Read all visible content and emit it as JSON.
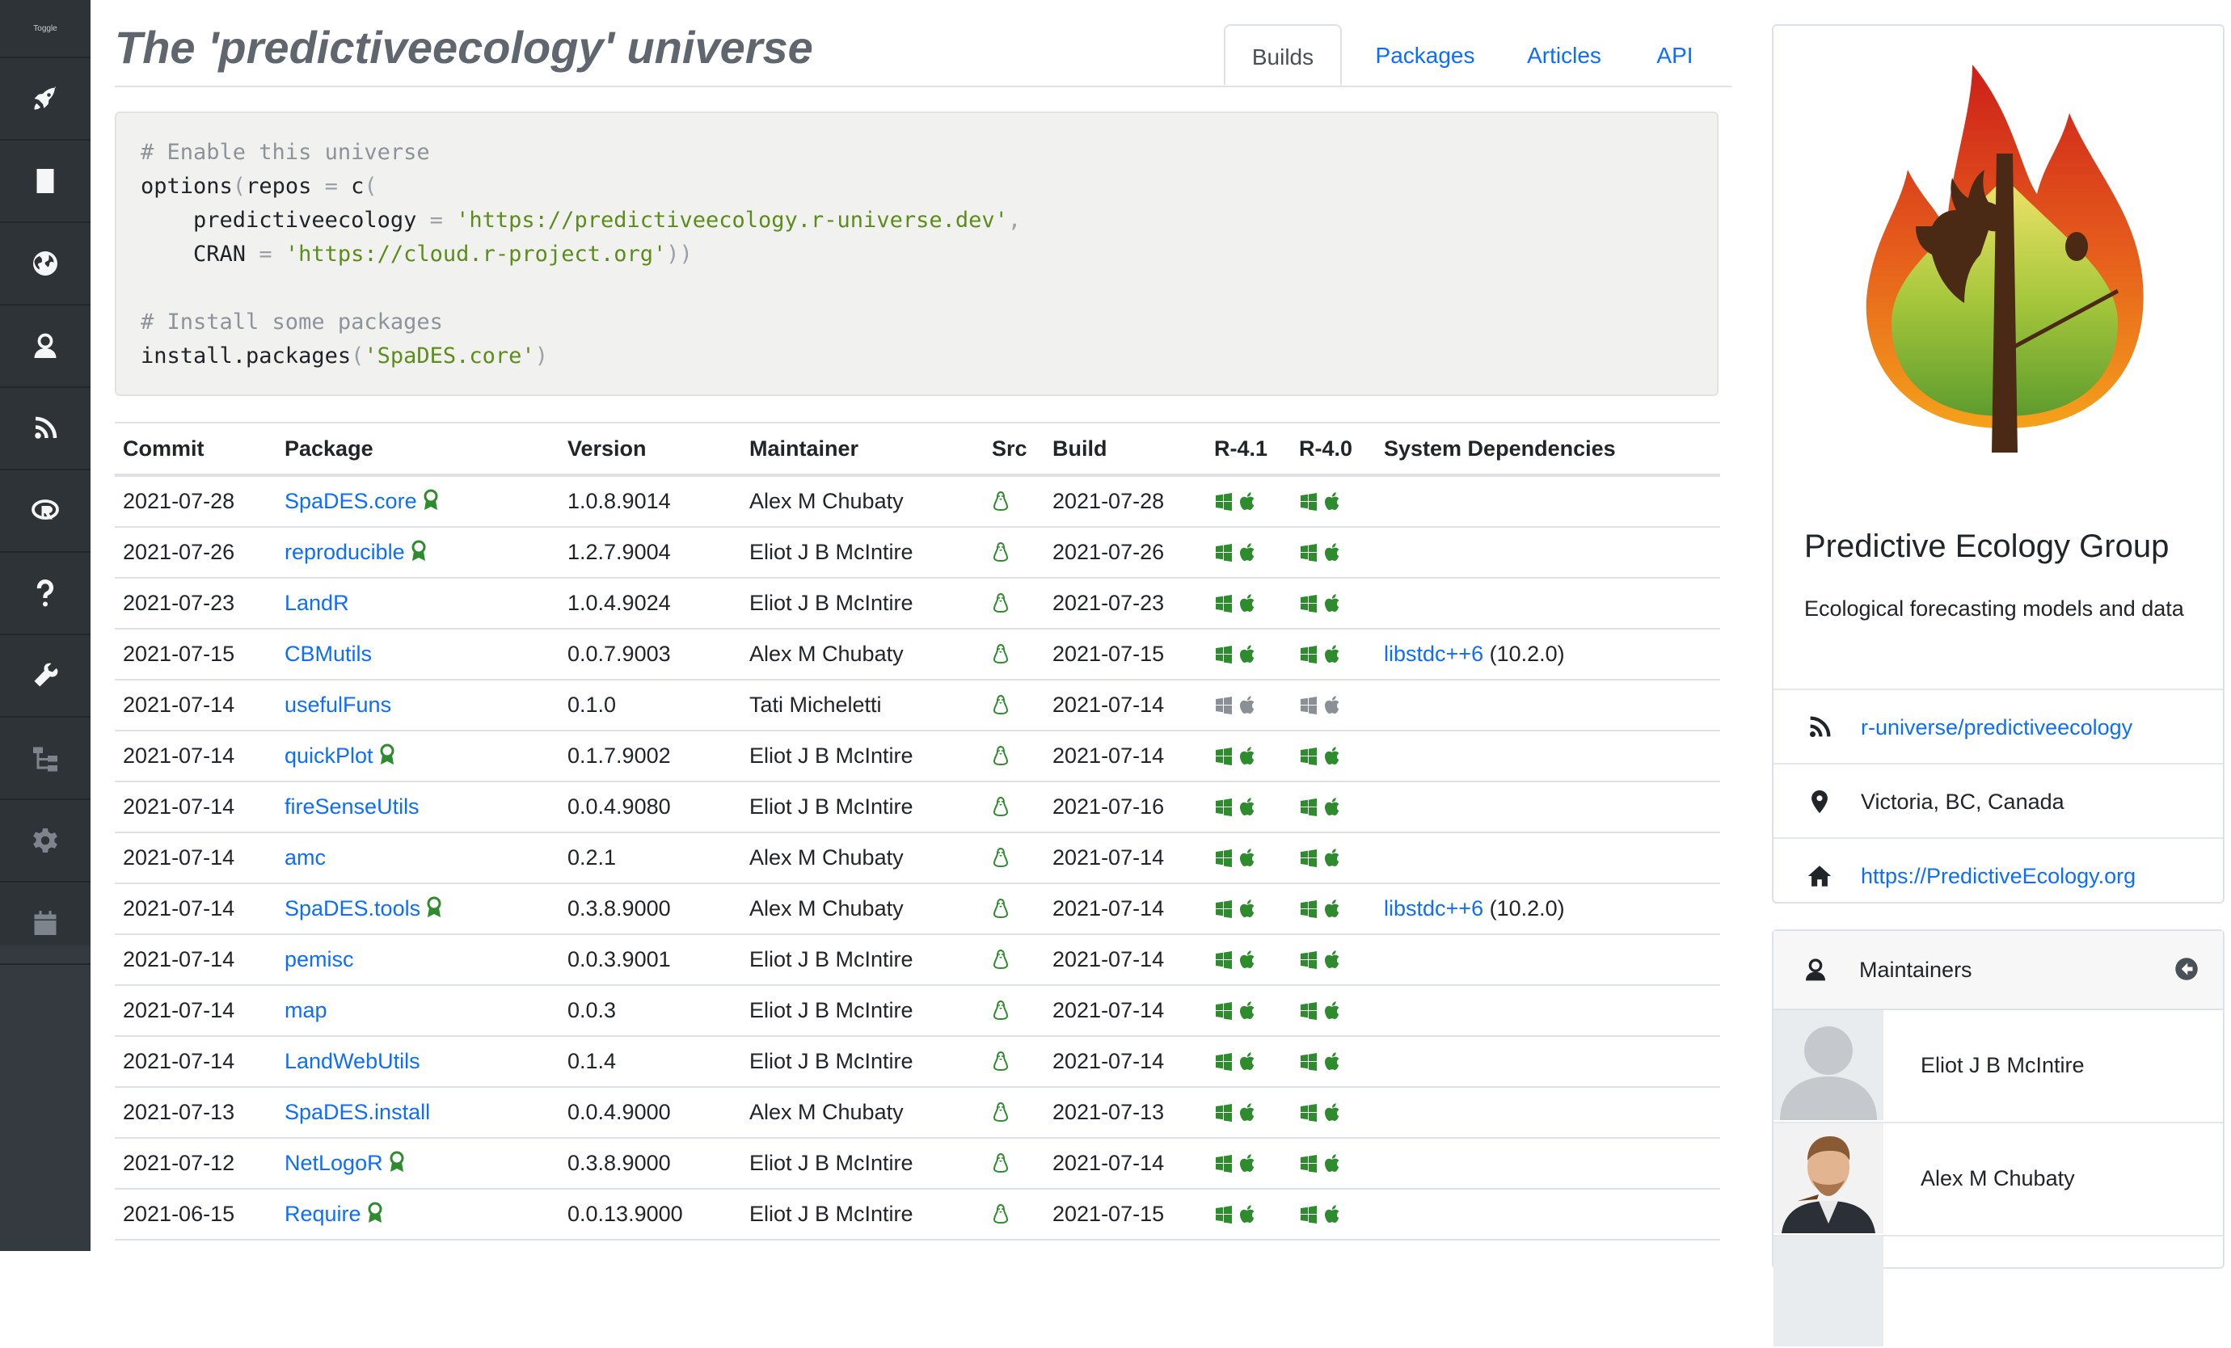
{
  "header": {
    "title": "The 'predictiveecology' universe",
    "tabs": [
      {
        "label": "Builds",
        "active": true
      },
      {
        "label": "Packages",
        "active": false
      },
      {
        "label": "Articles",
        "active": false
      },
      {
        "label": "API",
        "active": false
      }
    ]
  },
  "sidebar": {
    "top_label": "Toggle",
    "items": [
      {
        "icon": "rocket-icon"
      },
      {
        "icon": "book-icon"
      },
      {
        "icon": "globe-icon"
      },
      {
        "icon": "user-icon"
      },
      {
        "icon": "rss-icon"
      },
      {
        "icon": "r-logo-icon"
      },
      {
        "icon": "question-icon"
      },
      {
        "icon": "wrench-icon"
      },
      {
        "icon": "sitemap-icon"
      },
      {
        "icon": "gear-icon"
      },
      {
        "icon": "calendar-icon"
      }
    ]
  },
  "code": {
    "comment1": "# Enable this universe",
    "line2a": "options",
    "line2b": "(",
    "line2c": "repos ",
    "line2d": "= ",
    "line2e": "c",
    "line2f": "(",
    "line3a": "    predictiveecology ",
    "line3b": "= ",
    "line3c": "'https://predictiveecology.r-universe.dev'",
    "line3d": ",",
    "line4a": "    CRAN ",
    "line4b": "= ",
    "line4c": "'https://cloud.r-project.org'",
    "line4d": "))",
    "comment2": "# Install some packages",
    "line7a": "install.packages",
    "line7b": "(",
    "line7c": "'SpaDES.core'",
    "line7d": ")"
  },
  "table": {
    "headers": [
      "Commit",
      "Package",
      "Version",
      "Maintainer",
      "Src",
      "Build",
      "R-4.1",
      "R-4.0",
      "System Dependencies"
    ],
    "colors": {
      "ok": "#2e8b2e",
      "pending": "#8a9096",
      "link": "#0d6efd"
    },
    "rows": [
      {
        "commit": "2021-07-28",
        "package": "SpaDES.core",
        "award": true,
        "version": "1.0.8.9014",
        "maintainer": "Alex M Chubaty",
        "build": "2021-07-28",
        "status": "ok",
        "dep": "",
        "dep_ver": ""
      },
      {
        "commit": "2021-07-26",
        "package": "reproducible",
        "award": true,
        "version": "1.2.7.9004",
        "maintainer": "Eliot J B McIntire",
        "build": "2021-07-26",
        "status": "ok",
        "dep": "",
        "dep_ver": ""
      },
      {
        "commit": "2021-07-23",
        "package": "LandR",
        "award": false,
        "version": "1.0.4.9024",
        "maintainer": "Eliot J B McIntire",
        "build": "2021-07-23",
        "status": "ok",
        "dep": "",
        "dep_ver": ""
      },
      {
        "commit": "2021-07-15",
        "package": "CBMutils",
        "award": false,
        "version": "0.0.7.9003",
        "maintainer": "Alex M Chubaty",
        "build": "2021-07-15",
        "status": "ok",
        "dep": "libstdc++6",
        "dep_ver": " (10.2.0)"
      },
      {
        "commit": "2021-07-14",
        "package": "usefulFuns",
        "award": false,
        "version": "0.1.0",
        "maintainer": "Tati Micheletti",
        "build": "2021-07-14",
        "status": "pending",
        "dep": "",
        "dep_ver": ""
      },
      {
        "commit": "2021-07-14",
        "package": "quickPlot",
        "award": true,
        "version": "0.1.7.9002",
        "maintainer": "Eliot J B McIntire",
        "build": "2021-07-14",
        "status": "ok",
        "dep": "",
        "dep_ver": ""
      },
      {
        "commit": "2021-07-14",
        "package": "fireSenseUtils",
        "award": false,
        "version": "0.0.4.9080",
        "maintainer": "Eliot J B McIntire",
        "build": "2021-07-16",
        "status": "ok",
        "dep": "",
        "dep_ver": ""
      },
      {
        "commit": "2021-07-14",
        "package": "amc",
        "award": false,
        "version": "0.2.1",
        "maintainer": "Alex M Chubaty",
        "build": "2021-07-14",
        "status": "ok",
        "dep": "",
        "dep_ver": ""
      },
      {
        "commit": "2021-07-14",
        "package": "SpaDES.tools",
        "award": true,
        "version": "0.3.8.9000",
        "maintainer": "Alex M Chubaty",
        "build": "2021-07-14",
        "status": "ok",
        "dep": "libstdc++6",
        "dep_ver": " (10.2.0)"
      },
      {
        "commit": "2021-07-14",
        "package": "pemisc",
        "award": false,
        "version": "0.0.3.9001",
        "maintainer": "Eliot J B McIntire",
        "build": "2021-07-14",
        "status": "ok",
        "dep": "",
        "dep_ver": ""
      },
      {
        "commit": "2021-07-14",
        "package": "map",
        "award": false,
        "version": "0.0.3",
        "maintainer": "Eliot J B McIntire",
        "build": "2021-07-14",
        "status": "ok",
        "dep": "",
        "dep_ver": ""
      },
      {
        "commit": "2021-07-14",
        "package": "LandWebUtils",
        "award": false,
        "version": "0.1.4",
        "maintainer": "Eliot J B McIntire",
        "build": "2021-07-14",
        "status": "ok",
        "dep": "",
        "dep_ver": ""
      },
      {
        "commit": "2021-07-13",
        "package": "SpaDES.install",
        "award": false,
        "version": "0.0.4.9000",
        "maintainer": "Alex M Chubaty",
        "build": "2021-07-13",
        "status": "ok",
        "dep": "",
        "dep_ver": ""
      },
      {
        "commit": "2021-07-12",
        "package": "NetLogoR",
        "award": true,
        "version": "0.3.8.9000",
        "maintainer": "Eliot J B McIntire",
        "build": "2021-07-14",
        "status": "ok",
        "dep": "",
        "dep_ver": ""
      },
      {
        "commit": "2021-06-15",
        "package": "Require",
        "award": true,
        "version": "0.0.13.9000",
        "maintainer": "Eliot J B McIntire",
        "build": "2021-07-15",
        "status": "ok",
        "dep": "",
        "dep_ver": ""
      }
    ]
  },
  "org": {
    "name": "Predictive Ecology Group",
    "description": "Ecological forecasting models and data",
    "github": "r-universe/predictiveecology",
    "location": "Victoria, BC, Canada",
    "homepage": "https://PredictiveEcology.org"
  },
  "maintainers": {
    "title": "Maintainers",
    "people": [
      {
        "name": "Eliot J B McIntire",
        "avatar": "default-avatar"
      },
      {
        "name": "Alex M Chubaty",
        "avatar": "photo-avatar"
      }
    ]
  }
}
